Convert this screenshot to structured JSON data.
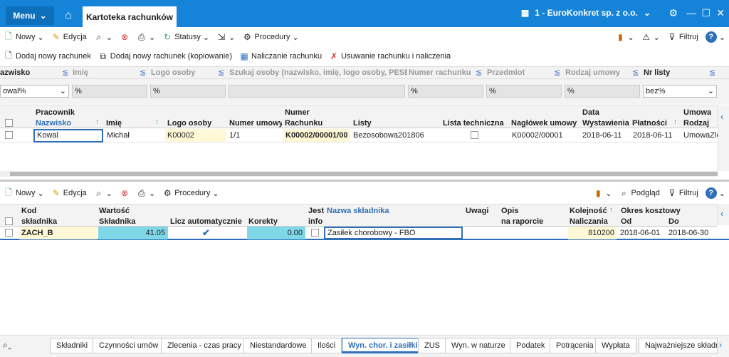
{
  "titlebar": {
    "menu": "Menu",
    "tab": "Kartoteka rachunków",
    "company": "1 - EuroKonkret sp. z o.o."
  },
  "toolbar1": {
    "nowy": "Nowy",
    "edycja": "Edycja",
    "statusy": "Statusy",
    "procedury": "Procedury",
    "filtruj": "Filtruj"
  },
  "toolbar2": {
    "dodaj": "Dodaj nowy rachunek",
    "dodaj_kop": "Dodaj nowy rachunek (kopiowanie)",
    "naliczanie": "Naliczanie rachunku",
    "usuwanie": "Usuwanie rachunku i naliczenia"
  },
  "filters": {
    "headers": [
      "azwisko",
      "Imię",
      "Logo osoby",
      "Szukaj osoby (nazwisko, imię, logo osoby, PESEL)",
      "Numer rachunku",
      "Przedmiot",
      "Rodzaj umowy",
      "Nr listy"
    ],
    "values": [
      "owal%",
      "%",
      "%",
      "",
      "%",
      "%",
      "%",
      "bez%"
    ]
  },
  "grid1": {
    "group": {
      "pracownik": "Pracownik",
      "numer": "Numer",
      "data": "Data",
      "umowa": "Umowa"
    },
    "cols": [
      "Nazwisko",
      "Imię",
      "Logo osoby",
      "Numer umowy",
      "Rachunku",
      "Listy",
      "Lista techniczna",
      "Nagłówek umowy",
      "Wystawienia",
      "Płatności",
      "Rodzaj"
    ],
    "row": [
      "Kowal",
      "Michał",
      "K00002",
      "1/1",
      "K00002/00001/00",
      "Bezosobowa201806",
      "",
      "K00002/00001",
      "2018-06-11",
      "2018-06-11",
      "UmowaZlecen"
    ]
  },
  "toolbar3": {
    "nowy": "Nowy",
    "edycja": "Edycja",
    "procedury": "Procedury",
    "podglad": "Podgląd",
    "filtruj": "Filtruj"
  },
  "grid2": {
    "group": {
      "kod": "Kod",
      "wartosc": "Wartość",
      "jest": "Jest",
      "uwagi": "Uwagi",
      "opis": "Opis",
      "kolejnosc": "Kolejność",
      "okres": "Okres kosztowy"
    },
    "cols": [
      "składnika",
      "Składnika",
      "Licz automatycznie",
      "Korekty",
      "info",
      "Nazwa składnika",
      "na raporcie",
      "Naliczania",
      "Od",
      "Do"
    ],
    "row": [
      "ZACH_B",
      "41.05",
      "",
      "0.00",
      "",
      "Zasiłek chorobowy - FBO",
      "",
      "",
      "810200",
      "2018-06-01",
      "2018-06-30"
    ]
  },
  "tabs": [
    "Składniki",
    "Czynności umów",
    "Zlecenia - czas pracy",
    "Niestandardowe",
    "Ilości",
    "Wyn. chor. i zasiłki",
    "ZUS",
    "Wyn. w naturze",
    "Podatek",
    "Potrącenia",
    "Wypłata",
    "Najważniejsze składn"
  ],
  "colors": {
    "accent": "#1584d8",
    "header_blue": "#2f6fba",
    "highlight_yellow": "#fff8d6",
    "cyan": "#7fd8e8"
  }
}
